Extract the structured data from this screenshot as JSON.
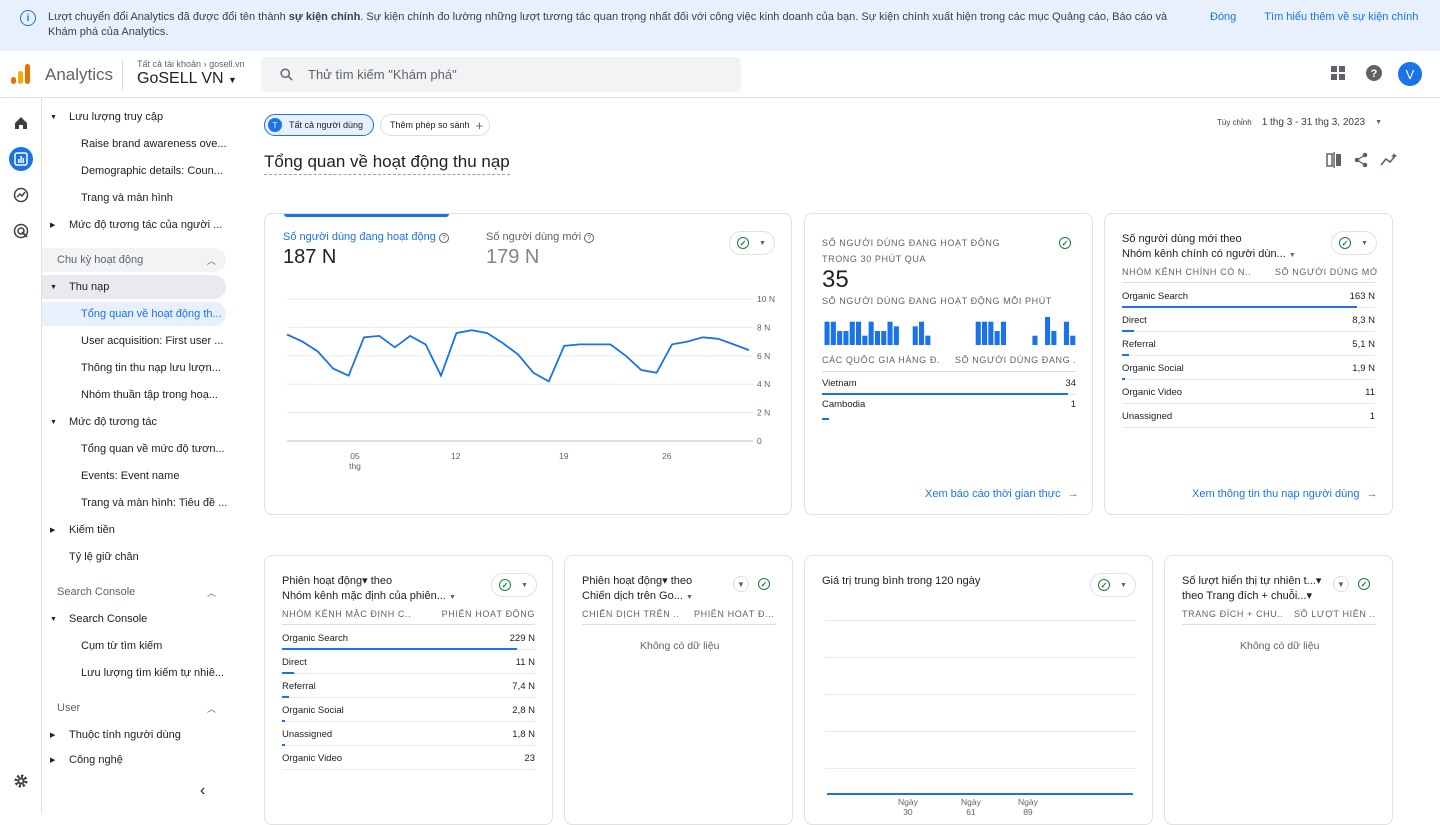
{
  "banner": {
    "msg_part1": "Lượt chuyển đổi Analytics đã được đổi tên thành ",
    "msg_bold": "sự kiện chính",
    "msg_part2": ". Sự kiện chính đo lường những lượt tương tác quan trọng nhất đối với công việc kinh doanh của bạn. Sự kiện chính xuất hiện trong các mục Quảng cáo, Báo cáo và Khám phá của Analytics.",
    "close_label": "Đóng",
    "learn_label": "Tìm hiểu thêm về sự kiện chính"
  },
  "header": {
    "app_name": "Analytics",
    "breadcrumb_all": "Tất cả tài khoản",
    "breadcrumb_account": "gosell.vn",
    "property": "GoSELL VN",
    "search_placeholder": "Thử tìm kiếm \"Khám phá\"",
    "avatar_letter": "V"
  },
  "nav": {
    "items": [
      {
        "label": "Lưu lượng truy cập",
        "level": 1,
        "arrow": "▼"
      },
      {
        "label": "Raise brand awareness ove...",
        "level": 2
      },
      {
        "label": "Demographic details: Coun...",
        "level": 2
      },
      {
        "label": "Trang và màn hình",
        "level": 2
      },
      {
        "label": "Mức độ tương tác của người ...",
        "level": 1,
        "arrow": "▶"
      }
    ],
    "section_lifecycle": "Chu kỳ hoạt động",
    "lifecycle_items": [
      {
        "label": "Thu nạp",
        "level": 1,
        "arrow": "▼"
      },
      {
        "label": "Tổng quan về hoạt động th...",
        "level": 2
      },
      {
        "label": "User acquisition: First user ...",
        "level": 2
      },
      {
        "label": "Thông tin thu nạp lưu lượn...",
        "level": 2
      },
      {
        "label": "Nhóm thuần tập trong hoạ...",
        "level": 2
      },
      {
        "label": "Mức độ tương tác",
        "level": 1,
        "arrow": "▼"
      },
      {
        "label": "Tổng quan về mức độ tươn...",
        "level": 2
      },
      {
        "label": "Events: Event name",
        "level": 2
      },
      {
        "label": "Trang và màn hình: Tiêu đề ...",
        "level": 2
      },
      {
        "label": "Kiếm tiền",
        "level": 1,
        "arrow": "▶"
      },
      {
        "label": "Tỷ lệ giữ chân",
        "level": 1
      }
    ],
    "section_search_console": "Search Console",
    "sc_items": [
      {
        "label": "Search Console",
        "level": 1,
        "arrow": "▼"
      },
      {
        "label": "Cụm từ tìm kiếm",
        "level": 2
      },
      {
        "label": "Lưu lượng tìm kiếm tự nhiê...",
        "level": 2
      }
    ],
    "section_user": "User",
    "user_items": [
      {
        "label": "Thuộc tính người dùng",
        "level": 1,
        "arrow": "▶"
      },
      {
        "label": "Công nghệ",
        "level": 1,
        "arrow": "▶"
      }
    ]
  },
  "filters": {
    "segment_letter": "T",
    "segment_label": "Tất cả người dùng",
    "compare_label": "Thêm phép so sánh",
    "date_prefix": "Tùy chỉnh",
    "date_range": "1 thg 3 - 31 thg 3, 2023"
  },
  "page": {
    "title": "Tổng quan về hoạt động thu nạp"
  },
  "overview_card": {
    "metric1_label": "Số người dùng đang hoạt động",
    "metric1_value": "187 N",
    "metric2_label": "Số người dùng mới",
    "metric2_value": "179 N",
    "x_labels": [
      "05",
      "12",
      "19",
      "26"
    ],
    "x_sub": "thg",
    "y_labels": [
      "10 N",
      "8 N",
      "6 N",
      "4 N",
      "2 N",
      "0"
    ]
  },
  "chart_data": {
    "type": "line",
    "x": [
      "1",
      "2",
      "3",
      "4",
      "5",
      "6",
      "7",
      "8",
      "9",
      "10",
      "11",
      "12",
      "13",
      "14",
      "15",
      "16",
      "17",
      "18",
      "19",
      "20",
      "21",
      "22",
      "23",
      "24",
      "25",
      "26",
      "27",
      "28",
      "29",
      "30",
      "31"
    ],
    "series": [
      {
        "values": [
          7.5,
          7.0,
          6.3,
          5.1,
          4.6,
          7.3,
          7.4,
          6.6,
          7.4,
          6.8,
          4.6,
          7.6,
          7.8,
          7.6,
          6.9,
          6.1,
          4.8,
          4.2,
          6.7,
          6.8,
          6.8,
          6.8,
          6.0,
          5.0,
          4.8,
          6.8,
          7.0,
          7.3,
          7.2,
          6.8,
          6.4
        ]
      }
    ],
    "ylim": [
      0,
      10
    ],
    "y_unit": "N"
  },
  "realtime_card": {
    "title": "Số người dùng đang hoạt động trong 30 phút qua",
    "value": "35",
    "sub": "Số người dùng đang hoạt động mỗi phút",
    "bars": [
      5,
      5,
      3,
      3,
      5,
      5,
      2,
      5,
      3,
      3,
      5,
      4,
      0,
      0,
      4,
      5,
      2,
      0,
      0,
      0,
      0,
      0,
      0,
      0,
      5,
      5,
      5,
      3,
      5,
      0,
      0,
      0,
      0,
      2,
      0,
      6,
      3,
      0,
      5,
      2
    ],
    "col1": "Các quốc gia hàng đ...",
    "col2": "Số người dùng đang ...",
    "rows": [
      {
        "label": "Vietnam",
        "value": "34",
        "pct": 1.0
      },
      {
        "label": "Cambodia",
        "value": "1",
        "pct": 0.03
      }
    ],
    "link": "Xem báo cáo thời gian thực"
  },
  "newusers_card": {
    "title1": "Số người dùng mới theo",
    "title2": "Nhóm kênh chính có người dùn...",
    "col1": "Nhóm kênh chính có n...",
    "col2": "Số người dùng mới",
    "rows": [
      {
        "label": "Organic Search",
        "value": "163 N",
        "pct": 1.0
      },
      {
        "label": "Direct",
        "value": "8,3 N",
        "pct": 0.05
      },
      {
        "label": "Referral",
        "value": "5,1 N",
        "pct": 0.03
      },
      {
        "label": "Organic Social",
        "value": "1,9 N",
        "pct": 0.012
      },
      {
        "label": "Organic Video",
        "value": "11",
        "pct": 0
      },
      {
        "label": "Unassigned",
        "value": "1",
        "pct": 0
      }
    ],
    "link": "Xem thông tin thu nạp người dùng"
  },
  "sessions_card": {
    "title1": "Phiên hoạt động▾ theo",
    "title2": "Nhóm kênh mặc định của phiên...",
    "col1": "Nhóm kênh mặc định c...",
    "col2": "Phiên hoạt động",
    "rows": [
      {
        "label": "Organic Search",
        "value": "229 N",
        "pct": 1.0
      },
      {
        "label": "Direct",
        "value": "11 N",
        "pct": 0.05
      },
      {
        "label": "Referral",
        "value": "7,4 N",
        "pct": 0.03
      },
      {
        "label": "Organic Social",
        "value": "2,8 N",
        "pct": 0.012
      },
      {
        "label": "Unassigned",
        "value": "1,8 N",
        "pct": 0.008
      },
      {
        "label": "Organic Video",
        "value": "23",
        "pct": 0
      }
    ]
  },
  "campaign_card": {
    "title1": "Phiên hoạt động▾ theo",
    "title2": "Chiến dịch trên Go...",
    "col1": "Chiến dịch trên ...",
    "col2": "Phiên hoạt đ...",
    "nodata": "Không có dữ liệu"
  },
  "ltv_card": {
    "title": "Giá trị trung bình trong 120 ngày",
    "x_labels": [
      {
        "top": "Ngày",
        "bottom": "30"
      },
      {
        "top": "Ngày",
        "bottom": "61"
      },
      {
        "top": "Ngày",
        "bottom": "89"
      }
    ]
  },
  "organic_card": {
    "title1": "Số lượt hiển thị tự nhiên t...▾",
    "title2": "theo Trang đích + chuỗi...▾",
    "col1": "Trang đích + chu...",
    "col2": "Số lượt hiển ...",
    "nodata": "Không có dữ liệu"
  },
  "colors": {
    "accent": "#1a73e8",
    "success": "#188038",
    "banner_bg": "#e8f0fe"
  }
}
